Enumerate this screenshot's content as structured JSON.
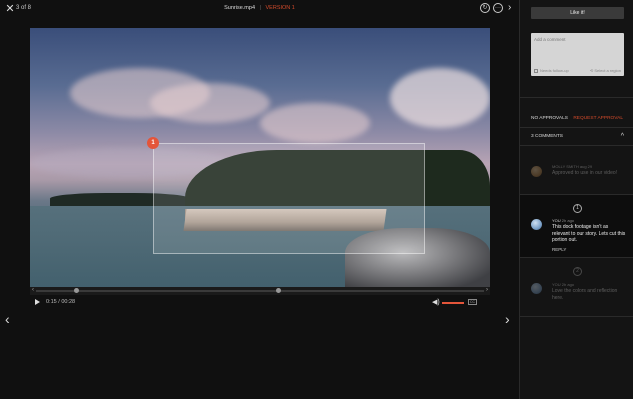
{
  "topbar": {
    "counter": "3 of 8",
    "filename": "Sunrise.mp4",
    "separator": "|",
    "version": "VERSION 1"
  },
  "player": {
    "region_badge": "1",
    "current_time": "0:15",
    "time_separator": "/",
    "duration": "00:28",
    "cc_label": "CC",
    "volume_level": 1.0,
    "playhead_fraction": 0.1
  },
  "panel": {
    "like_label": "Like it!",
    "comment_placeholder": "Add a comment",
    "needs_followup_label": "Needs follow-up",
    "select_region_label": "Select a region",
    "no_approvals": "NO APPROVALS",
    "request_approval": "REQUEST APPROVAL",
    "comments_count": "3 COMMENTS",
    "comments": [
      {
        "author": "MOLLY SMITH",
        "time": "aug 29",
        "text": "Approved to use in our video!",
        "number": "",
        "reply": ""
      },
      {
        "author": "YOU",
        "time": "2h ago",
        "text": "This dock footage isn't as relevant to our story. Lets cut this portion out.",
        "number": "1",
        "reply": "REPLY"
      },
      {
        "author": "YOU",
        "time": "2h ago",
        "text": "Love the colors and reflection here.",
        "number": "2",
        "reply": ""
      }
    ]
  },
  "colors": {
    "accent": "#e4553a",
    "version": "#d44b2b"
  }
}
